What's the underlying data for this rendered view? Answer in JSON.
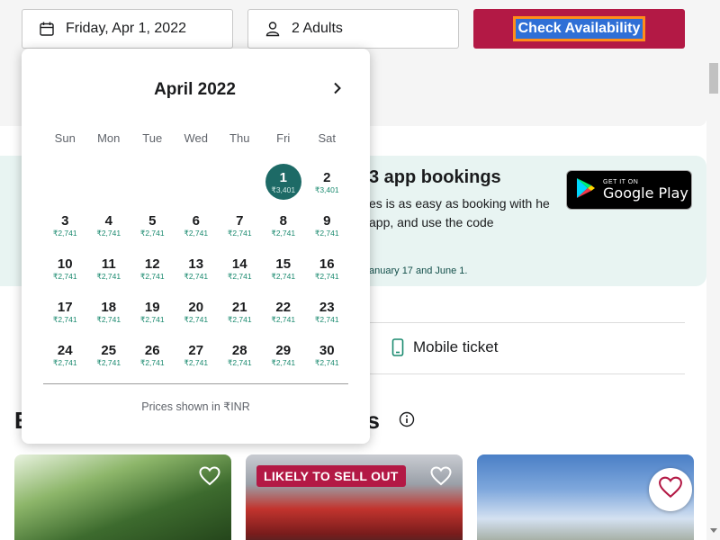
{
  "booking": {
    "date_value": "Friday, Apr 1, 2022",
    "date_icon": "calendar-icon",
    "guests_value": "2 Adults",
    "guests_icon": "person-icon",
    "check_label": "Check Availability"
  },
  "calendar": {
    "month_label": "April 2022",
    "next_icon": "chevron-right-icon",
    "weekdays": [
      "Sun",
      "Mon",
      "Tue",
      "Wed",
      "Thu",
      "Fri",
      "Sat"
    ],
    "leading_blank_days": 5,
    "selected_day": "1",
    "days": [
      {
        "day": "1",
        "price": "₹3,401"
      },
      {
        "day": "2",
        "price": "₹3,401"
      },
      {
        "day": "3",
        "price": "₹2,741"
      },
      {
        "day": "4",
        "price": "₹2,741"
      },
      {
        "day": "5",
        "price": "₹2,741"
      },
      {
        "day": "6",
        "price": "₹2,741"
      },
      {
        "day": "7",
        "price": "₹2,741"
      },
      {
        "day": "8",
        "price": "₹2,741"
      },
      {
        "day": "9",
        "price": "₹2,741"
      },
      {
        "day": "10",
        "price": "₹2,741"
      },
      {
        "day": "11",
        "price": "₹2,741"
      },
      {
        "day": "12",
        "price": "₹2,741"
      },
      {
        "day": "13",
        "price": "₹2,741"
      },
      {
        "day": "14",
        "price": "₹2,741"
      },
      {
        "day": "15",
        "price": "₹2,741"
      },
      {
        "day": "16",
        "price": "₹2,741"
      },
      {
        "day": "17",
        "price": "₹2,741"
      },
      {
        "day": "18",
        "price": "₹2,741"
      },
      {
        "day": "19",
        "price": "₹2,741"
      },
      {
        "day": "20",
        "price": "₹2,741"
      },
      {
        "day": "21",
        "price": "₹2,741"
      },
      {
        "day": "22",
        "price": "₹2,741"
      },
      {
        "day": "23",
        "price": "₹2,741"
      },
      {
        "day": "24",
        "price": "₹2,741"
      },
      {
        "day": "25",
        "price": "₹2,741"
      },
      {
        "day": "26",
        "price": "₹2,741"
      },
      {
        "day": "27",
        "price": "₹2,741"
      },
      {
        "day": "28",
        "price": "₹2,741"
      },
      {
        "day": "29",
        "price": "₹2,741"
      },
      {
        "day": "30",
        "price": "₹2,741"
      }
    ],
    "footer_note": "Prices shown in ₹INR"
  },
  "promo": {
    "title": "3 app bookings",
    "text": "es is as easy as booking with he app, and use the code",
    "note": "anuary 17 and June 1.",
    "store_small": "GET IT ON",
    "store_big": "Google Play"
  },
  "features": {
    "mobile_ticket": "Mobile ticket",
    "mobile_icon": "phone-icon"
  },
  "section": {
    "heading_left": "E",
    "heading_right": "es",
    "info_icon": "info-icon"
  },
  "cards": {
    "badge": "LIKELY TO SELL OUT",
    "heart_icon": "heart-icon"
  },
  "colors": {
    "brand": "#b31945",
    "selected_day": "#1d6a66",
    "price_green": "#1a8a6f",
    "promo_bg": "#e8f4f2"
  }
}
